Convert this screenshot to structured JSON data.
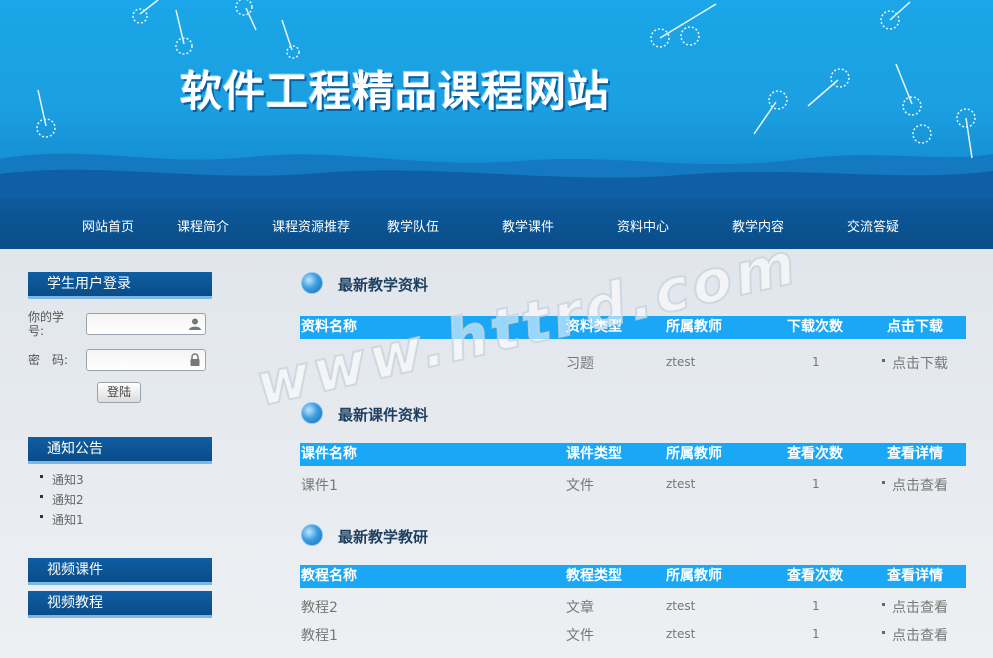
{
  "header": {
    "site_title": "软件工程精品课程网站"
  },
  "nav": {
    "items": [
      {
        "label": "网站首页"
      },
      {
        "label": "课程简介"
      },
      {
        "label": "课程资源推荐"
      },
      {
        "label": "教学队伍"
      },
      {
        "label": "教学课件"
      },
      {
        "label": "资料中心"
      },
      {
        "label": "教学内容"
      },
      {
        "label": "交流答疑"
      }
    ]
  },
  "sidebar": {
    "login": {
      "title": "学生用户登录",
      "id_label_line1": "你的学",
      "id_label_line2": "号:",
      "password_label": "密　码:",
      "id_value": "",
      "password_value": "",
      "submit_label": "登陆",
      "user_icon": "user-icon",
      "lock_icon": "lock-icon"
    },
    "notice": {
      "title": "通知公告",
      "items": [
        "通知3",
        "通知2",
        "通知1"
      ]
    },
    "video_courseware": {
      "title": "视频课件"
    },
    "video_tutorial": {
      "title": "视频教程"
    }
  },
  "main": {
    "materials": {
      "title": "最新教学资料",
      "columns": [
        "资料名称",
        "资料类型",
        "所属教师",
        "下载次数",
        "点击下载"
      ],
      "rows": [
        {
          "name": "",
          "type": "习题",
          "teacher": "ztest",
          "count": "1",
          "action": "点击下载"
        }
      ]
    },
    "courseware": {
      "title": "最新课件资料",
      "columns": [
        "课件名称",
        "课件类型",
        "所属教师",
        "查看次数",
        "查看详情"
      ],
      "rows": [
        {
          "name": "课件1",
          "type": "文件",
          "teacher": "ztest",
          "count": "1",
          "action": "点击查看"
        }
      ]
    },
    "research": {
      "title": "最新教学教研",
      "columns": [
        "教程名称",
        "教程类型",
        "所属教师",
        "查看次数",
        "查看详情"
      ],
      "rows": [
        {
          "name": "教程2",
          "type": "文章",
          "teacher": "ztest",
          "count": "1",
          "action": "点击查看"
        },
        {
          "name": "教程1",
          "type": "文件",
          "teacher": "ztest",
          "count": "1",
          "action": "点击查看"
        }
      ]
    }
  },
  "watermark": "www.httrd.com",
  "colors": {
    "banner_blue": "#1aa6e8",
    "nav_blue": "#0a4d88",
    "table_header": "#1aa7f5",
    "sidebar_title": "#0f5ea3"
  }
}
